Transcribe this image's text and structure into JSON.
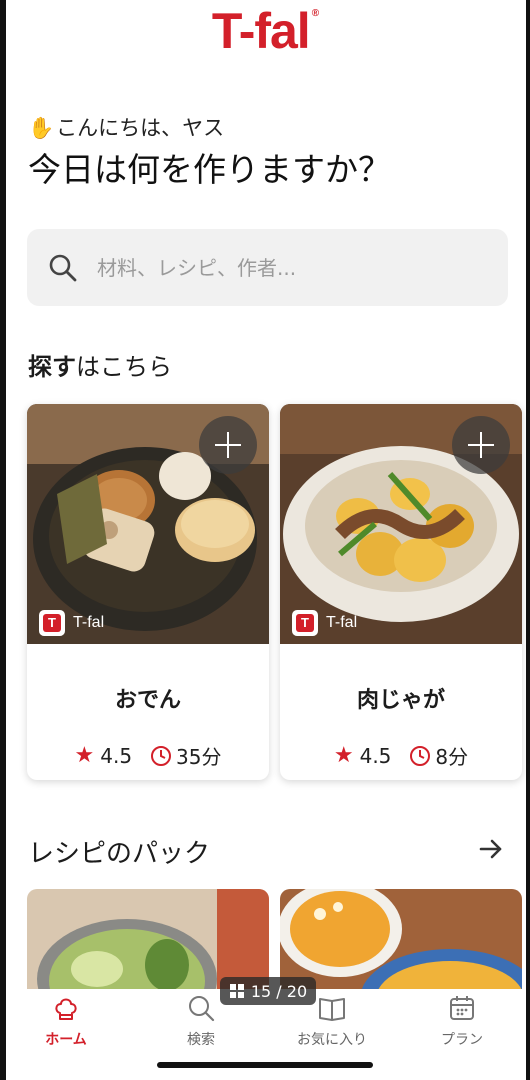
{
  "app": {
    "logo": "T-fal",
    "logo_mark": "®"
  },
  "greeting": {
    "wave_icon": "waving-hand-icon",
    "hello": "こんにちは、ヤス",
    "question": "今日は何を作りますか？"
  },
  "search": {
    "placeholder": "材料、レシピ、作者..."
  },
  "explore": {
    "title_bold": "探す",
    "title_rest": "はこちら"
  },
  "recipes": [
    {
      "title": "おでん",
      "brand": "T-fal",
      "rating": "4.5",
      "time": "35分"
    },
    {
      "title": "肉じゃが",
      "brand": "T-fal",
      "rating": "4.5",
      "time": "8分"
    }
  ],
  "packs": {
    "title": "レシピのパック"
  },
  "page_indicator": "15 / 20",
  "tabs": [
    {
      "label": "ホーム",
      "icon": "chef-hat-icon",
      "active": true
    },
    {
      "label": "検索",
      "icon": "search-icon",
      "active": false
    },
    {
      "label": "お気に入り",
      "icon": "book-icon",
      "active": false
    },
    {
      "label": "プラン",
      "icon": "calendar-icon",
      "active": false
    }
  ],
  "colors": {
    "brand": "#d3202a",
    "search_bg": "#f1f1f1"
  }
}
